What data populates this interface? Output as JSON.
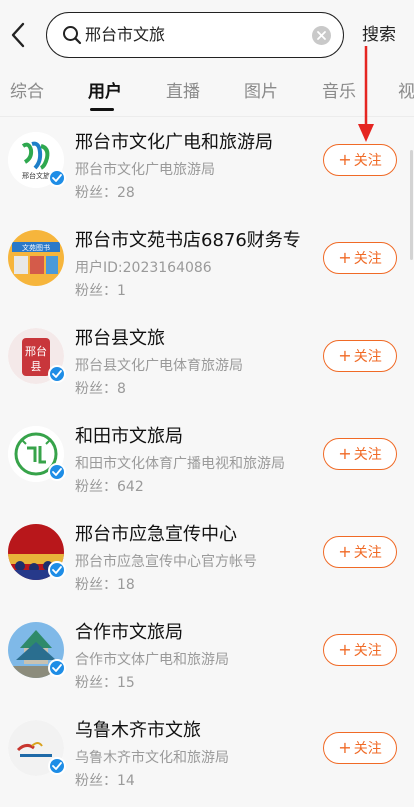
{
  "header": {
    "query": "邢台市文旅",
    "search_label": "搜索"
  },
  "tabs": [
    {
      "label": "综合"
    },
    {
      "label": "用户"
    },
    {
      "label": "直播"
    },
    {
      "label": "图片"
    },
    {
      "label": "音乐"
    },
    {
      "label": "视"
    }
  ],
  "active_tab": "用户",
  "accent_color": "#f06a26",
  "users": [
    {
      "name": "邢台市文化广电和旅游局",
      "sub": "邢台市文化广电旅游局",
      "fans": "粉丝：28",
      "follow": "关注",
      "avatar": "xingtai-culture-logo"
    },
    {
      "name": "邢台市文苑书店6876财务专",
      "sub": "用户ID:2023164086",
      "fans": "粉丝：1",
      "follow": "关注",
      "avatar": "wenyuan-bookstore-logo"
    },
    {
      "name": "邢台县文旅",
      "sub": "邢台县文化广电体育旅游局",
      "fans": "粉丝：8",
      "follow": "关注",
      "avatar": "xingtai-county-logo"
    },
    {
      "name": "和田市文旅局",
      "sub": "和田市文化体育广播电视和旅游局",
      "fans": "粉丝：642",
      "follow": "关注",
      "avatar": "hetian-logo"
    },
    {
      "name": "邢台市应急宣传中心",
      "sub": "邢台市应急宣传中心官方帐号",
      "fans": "粉丝：18",
      "follow": "关注",
      "avatar": "emergency-center-photo"
    },
    {
      "name": "合作市文旅局",
      "sub": "合作市文体广电和旅游局",
      "fans": "粉丝：15",
      "follow": "关注",
      "avatar": "hezuo-temple-photo"
    },
    {
      "name": "乌鲁木齐市文旅",
      "sub": "乌鲁木齐市文化和旅游局",
      "fans": "粉丝：14",
      "follow": "关注",
      "avatar": "urumqi-logo"
    }
  ]
}
